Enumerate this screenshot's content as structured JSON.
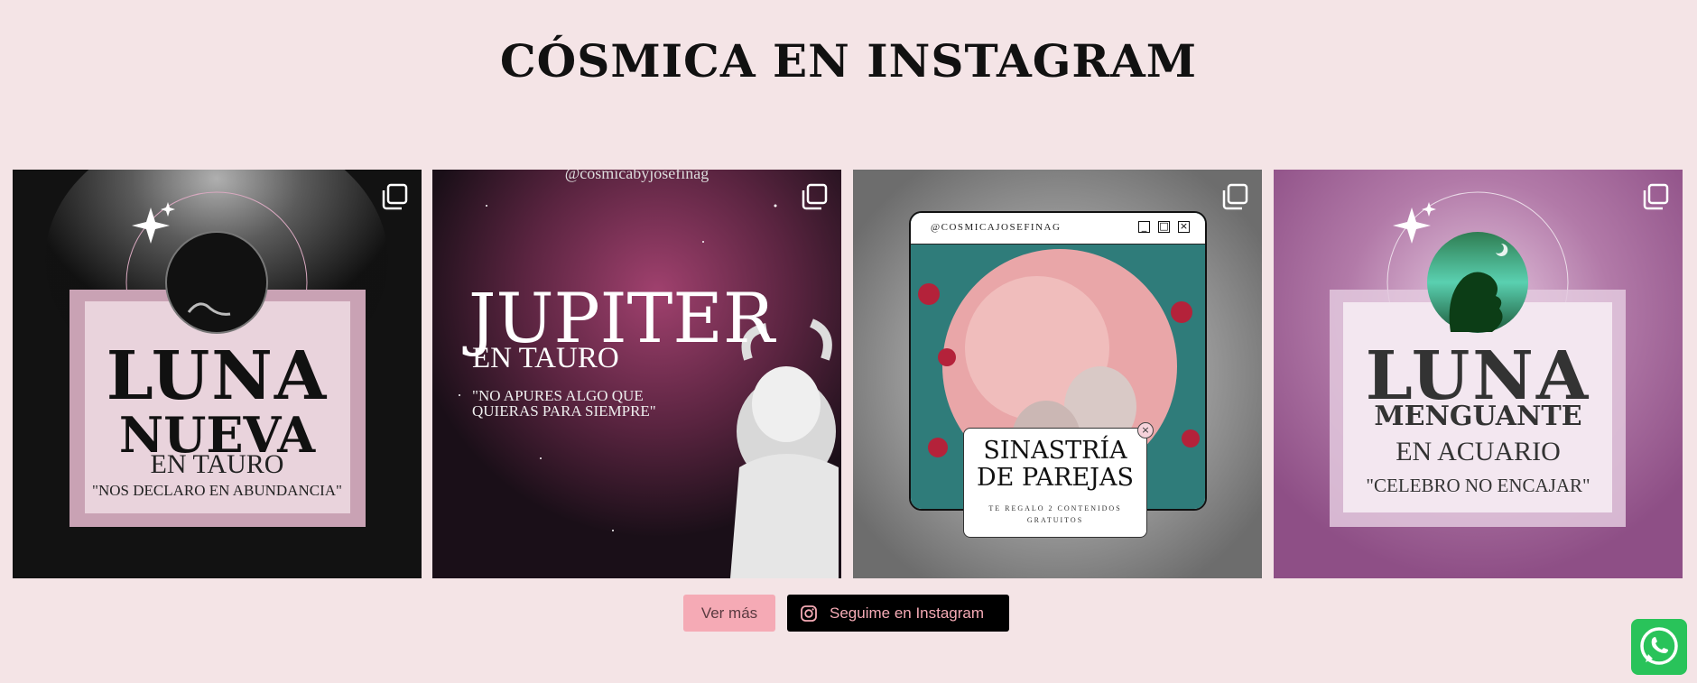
{
  "section": {
    "title": "CÓSMICA EN INSTAGRAM"
  },
  "posts": [
    {
      "icon": "multiple-images-icon",
      "line1": "LUNA",
      "line2": "NUEVA",
      "line3": "EN TAURO",
      "quote": "\"NOS DECLARO EN ABUNDANCIA\""
    },
    {
      "icon": "multiple-images-icon",
      "handle": "@cosmicabyjosefinag",
      "line1": "JUPITER",
      "line2": "EN TAURO",
      "quote": "\"NO APURES ALGO QUE QUIERAS PARA SIEMPRE\""
    },
    {
      "icon": "multiple-images-icon",
      "handle": "@COSMICAJOSEFINAG",
      "card_title": "SINASTRÍA DE PAREJAS",
      "card_sub": "TE REGALO 2 CONTENIDOS GRATUITOS"
    },
    {
      "icon": "multiple-images-icon",
      "line1": "LUNA",
      "line2": "MENGUANTE",
      "line3": "EN ACUARIO",
      "quote": "\"CELEBRO NO ENCAJAR\""
    }
  ],
  "buttons": {
    "more_label": "Ver más",
    "follow_label": "Seguime en Instagram",
    "follow_icon": "instagram-icon"
  },
  "floating": {
    "icon": "whatsapp-icon"
  },
  "colors": {
    "background": "#f4e4e6",
    "accent_pink": "#f5aab5",
    "whatsapp_green": "#29c35a"
  }
}
